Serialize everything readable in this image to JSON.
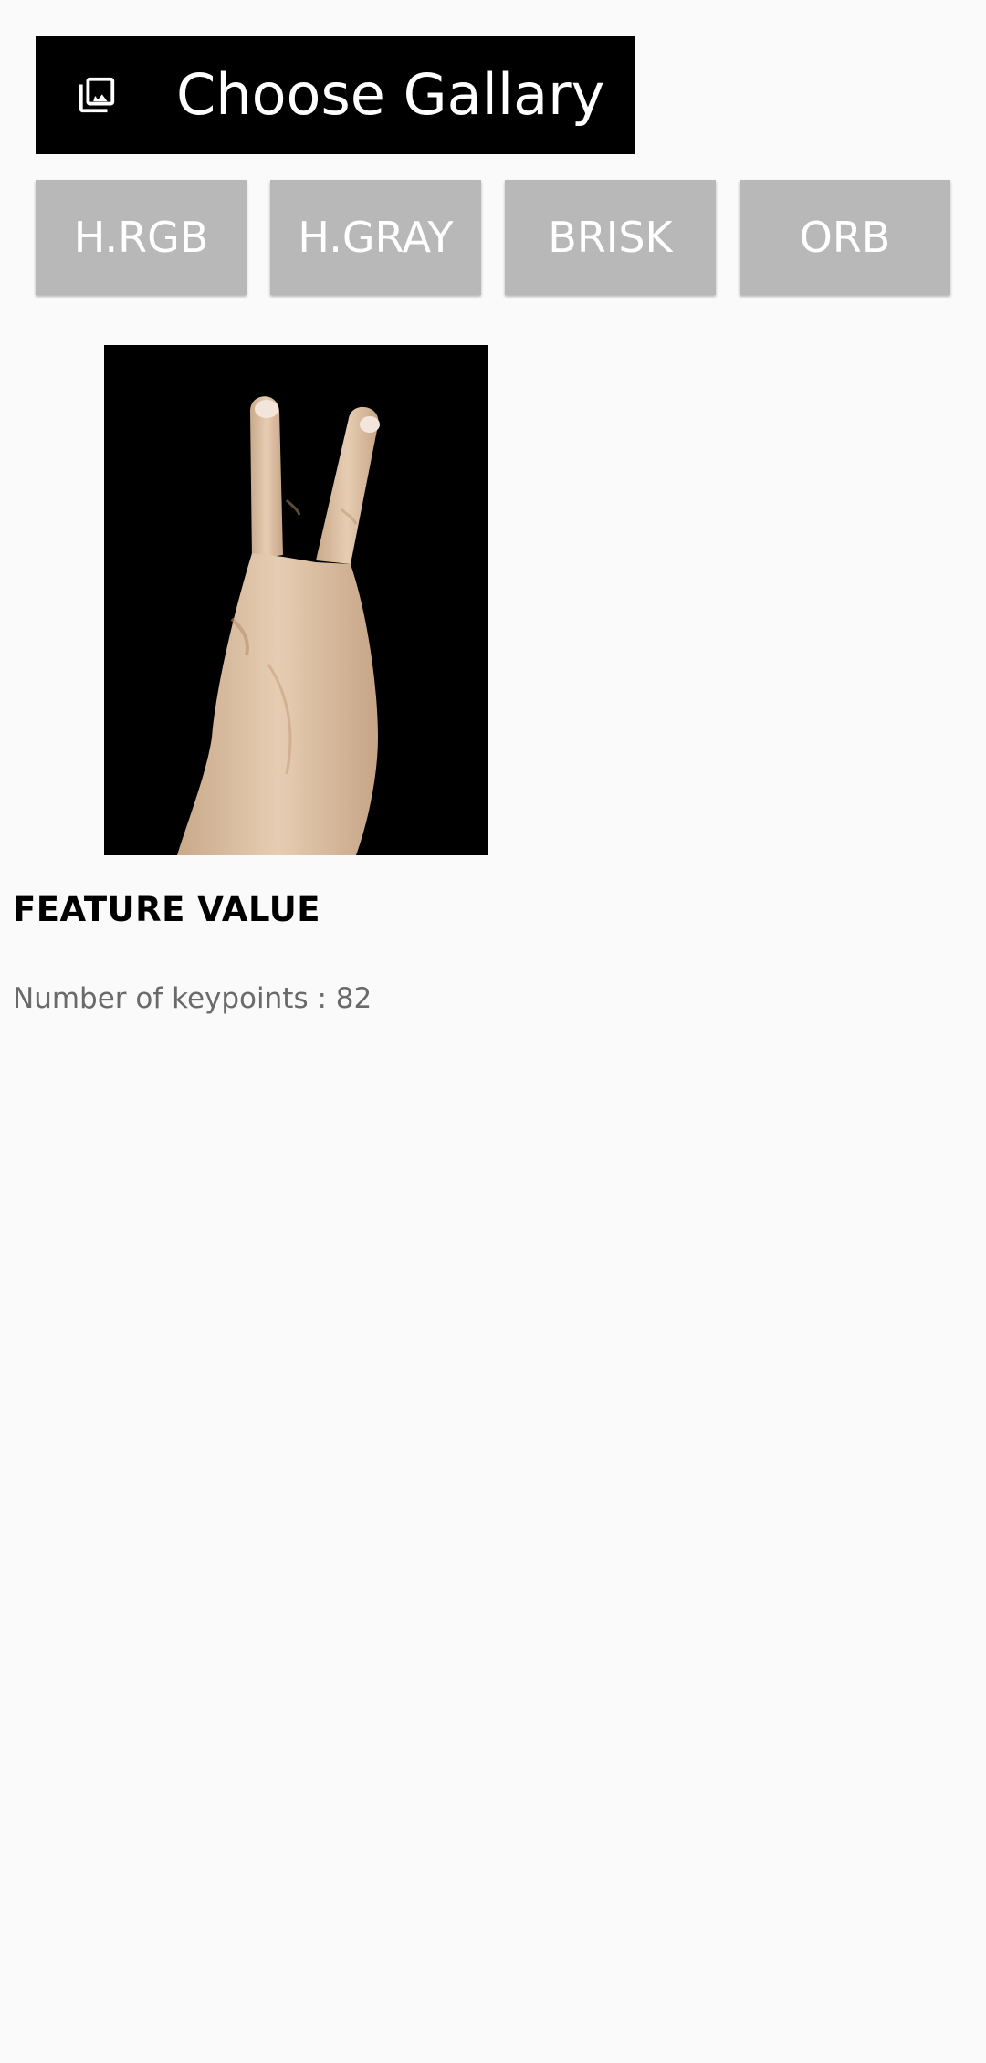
{
  "gallery_button": {
    "label": "Choose Gallary",
    "icon": "gallery-icon"
  },
  "feature_buttons": [
    {
      "label": "H.RGB"
    },
    {
      "label": "H.GRAY"
    },
    {
      "label": "BRISK"
    },
    {
      "label": "ORB"
    }
  ],
  "preview": {
    "description_icon": "hand-image"
  },
  "feature_section": {
    "heading": "FEATURE VALUE",
    "result": "Number of keypoints : 82"
  },
  "colors": {
    "background": "#fafafa",
    "gallery_button_bg": "#000000",
    "feature_button_bg": "#b8b8b8",
    "button_text": "#ffffff",
    "result_text": "#6a6a6a"
  }
}
